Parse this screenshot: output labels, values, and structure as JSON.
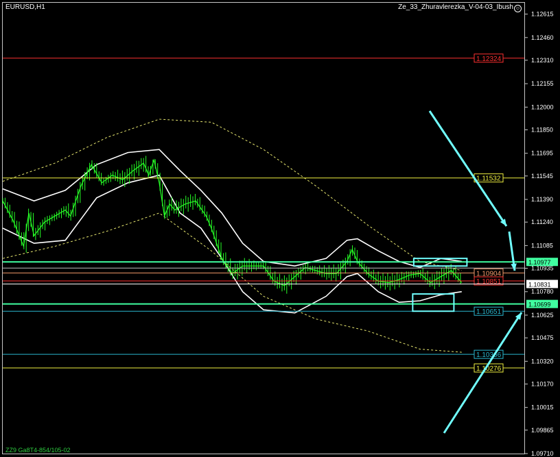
{
  "window": {
    "symbol": "EURUSD,H1",
    "indicator": "Ze_33_Zhuravlerezka_V-04-03_Ibush",
    "footer_text": "ZZ9 Ga8T4-854/105-02"
  },
  "colors": {
    "background": "#000000",
    "price_bars": "#26ff26",
    "band_white": "#ffffff",
    "envelope_yellow": "#e8e870",
    "channel_cyan": "#2ab8d0",
    "channel_salmon": "#f59a6a",
    "level_red": "#ff3030",
    "level_yellow": "#f0f040",
    "level_green": "#40ffa0",
    "box_cyan": "#70ffff"
  },
  "chart_data": {
    "type": "line",
    "title": "EURUSD,H1",
    "ylim": [
      1.0971,
      1.1269
    ],
    "y_ticks": [
      "1.12615",
      "1.12460",
      "1.12310",
      "1.12155",
      "1.12000",
      "1.11850",
      "1.11695",
      "1.11545",
      "1.11390",
      "1.11240",
      "1.11085",
      "1.10935",
      "1.10780",
      "1.10625",
      "1.10475",
      "1.10320",
      "1.10170",
      "1.10015",
      "1.09865",
      "1.09710"
    ],
    "x_range": [
      0,
      100
    ],
    "price_series": [
      [
        0,
        1.1138
      ],
      [
        2,
        1.1125
      ],
      [
        4,
        1.1108
      ],
      [
        5,
        1.113
      ],
      [
        6,
        1.1115
      ],
      [
        8,
        1.1124
      ],
      [
        10,
        1.1128
      ],
      [
        12,
        1.1132
      ],
      [
        13,
        1.1128
      ],
      [
        15,
        1.1148
      ],
      [
        17,
        1.1162
      ],
      [
        19,
        1.115
      ],
      [
        21,
        1.1155
      ],
      [
        23,
        1.1152
      ],
      [
        25,
        1.1158
      ],
      [
        27,
        1.1163
      ],
      [
        28,
        1.1155
      ],
      [
        29,
        1.1165
      ],
      [
        30,
        1.115
      ],
      [
        31,
        1.1128
      ],
      [
        32,
        1.1136
      ],
      [
        33,
        1.1132
      ],
      [
        35,
        1.1136
      ],
      [
        37,
        1.1138
      ],
      [
        39,
        1.1128
      ],
      [
        40,
        1.112
      ],
      [
        42,
        1.11
      ],
      [
        44,
        1.109
      ],
      [
        46,
        1.1095
      ],
      [
        48,
        1.1095
      ],
      [
        50,
        1.1095
      ],
      [
        52,
        1.1085
      ],
      [
        54,
        1.1082
      ],
      [
        56,
        1.1088
      ],
      [
        58,
        1.1094
      ],
      [
        60,
        1.1092
      ],
      [
        62,
        1.109
      ],
      [
        64,
        1.109
      ],
      [
        66,
        1.1098
      ],
      [
        67,
        1.1106
      ],
      [
        68,
        1.1098
      ],
      [
        70,
        1.109
      ],
      [
        72,
        1.1085
      ],
      [
        74,
        1.1084
      ],
      [
        76,
        1.1086
      ],
      [
        78,
        1.1089
      ],
      [
        80,
        1.109
      ],
      [
        82,
        1.1084
      ],
      [
        84,
        1.1088
      ],
      [
        86,
        1.1092
      ],
      [
        87,
        1.1088
      ],
      [
        88,
        1.1084
      ]
    ],
    "series": [
      {
        "values": [
          [
            0,
            1.1146
          ],
          [
            6,
            1.1138
          ],
          [
            12,
            1.1145
          ],
          [
            18,
            1.1162
          ],
          [
            24,
            1.117
          ],
          [
            30,
            1.1172
          ],
          [
            34,
            1.1158
          ],
          [
            38,
            1.1145
          ],
          [
            42,
            1.113
          ],
          [
            46,
            1.111
          ],
          [
            50,
            1.1098
          ],
          [
            56,
            1.1095
          ],
          [
            62,
            1.11
          ],
          [
            66,
            1.1112
          ],
          [
            68,
            1.1113
          ],
          [
            72,
            1.1105
          ],
          [
            76,
            1.1098
          ],
          [
            80,
            1.1094
          ],
          [
            84,
            1.11
          ],
          [
            88,
            1.1098
          ]
        ]
      },
      {
        "values": [
          [
            0,
            1.112
          ],
          [
            6,
            1.111
          ],
          [
            12,
            1.1112
          ],
          [
            18,
            1.114
          ],
          [
            24,
            1.115
          ],
          [
            30,
            1.1155
          ],
          [
            34,
            1.113
          ],
          [
            38,
            1.112
          ],
          [
            42,
            1.11
          ],
          [
            46,
            1.1078
          ],
          [
            50,
            1.1066
          ],
          [
            56,
            1.1064
          ],
          [
            62,
            1.1075
          ],
          [
            66,
            1.1088
          ],
          [
            68,
            1.109
          ],
          [
            72,
            1.1078
          ],
          [
            76,
            1.1071
          ],
          [
            80,
            1.1072
          ],
          [
            84,
            1.1076
          ],
          [
            88,
            1.1078
          ]
        ]
      },
      {
        "values": [
          [
            0,
            1.1151
          ],
          [
            10,
            1.1163
          ],
          [
            20,
            1.118
          ],
          [
            30,
            1.1192
          ],
          [
            40,
            1.119
          ],
          [
            50,
            1.1172
          ],
          [
            60,
            1.1148
          ],
          [
            70,
            1.1122
          ],
          [
            80,
            1.1098
          ],
          [
            88,
            1.1092
          ]
        ]
      },
      {
        "values": [
          [
            0,
            1.11
          ],
          [
            10,
            1.1108
          ],
          [
            20,
            1.1118
          ],
          [
            30,
            1.113
          ],
          [
            40,
            1.1105
          ],
          [
            50,
            1.1075
          ],
          [
            60,
            1.106
          ],
          [
            70,
            1.1052
          ],
          [
            80,
            1.104
          ],
          [
            88,
            1.1038
          ]
        ]
      }
    ],
    "levels": [
      {
        "label": "1.12324",
        "value": 1.12324,
        "color": "#ff3030"
      },
      {
        "label": "1.11532",
        "value": 1.11532,
        "color": "#f0f040"
      },
      {
        "label": "1.10977",
        "value": 1.10977,
        "color": "#40ffa0"
      },
      {
        "label": "1.10936",
        "value": 1.10936,
        "color": "#c0c0c0"
      },
      {
        "label": "1.10904",
        "value": 1.10904,
        "color": "#f59a6a"
      },
      {
        "label": "1.10851",
        "value": 1.10851,
        "color": "#ff3030"
      },
      {
        "label": "1.10831",
        "value": 1.10831,
        "color": "#ffffff"
      },
      {
        "label": "1.10699",
        "value": 1.10699,
        "color": "#40ffa0"
      },
      {
        "label": "1.10651",
        "value": 1.10651,
        "color": "#2ab8d0"
      },
      {
        "label": "1.10366",
        "value": 1.10366,
        "color": "#2ab8d0"
      },
      {
        "label": "1.10276",
        "value": 1.10276,
        "color": "#f0f040"
      }
    ],
    "grid": false
  }
}
